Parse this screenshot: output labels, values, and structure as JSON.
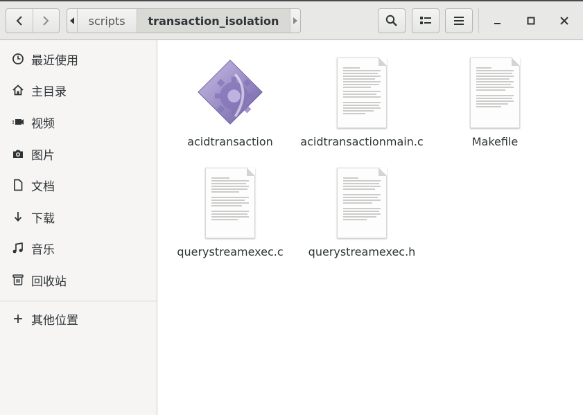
{
  "header": {
    "path": [
      "scripts",
      "transaction_isolation"
    ],
    "active_crumb": "transaction_isolation"
  },
  "sidebar": {
    "items": [
      {
        "label": "最近使用",
        "icon": "clock-icon"
      },
      {
        "label": "主目录",
        "icon": "home-icon"
      },
      {
        "label": "视频",
        "icon": "video-icon"
      },
      {
        "label": "图片",
        "icon": "camera-icon"
      },
      {
        "label": "文档",
        "icon": "document-icon"
      },
      {
        "label": "下载",
        "icon": "download-icon"
      },
      {
        "label": "音乐",
        "icon": "music-icon"
      },
      {
        "label": "回收站",
        "icon": "trash-icon"
      }
    ],
    "other": {
      "label": "其他位置",
      "icon": "plus-icon"
    }
  },
  "files": [
    {
      "name": "acidtransaction",
      "type": "executable"
    },
    {
      "name": "acidtransactionmain.c",
      "type": "text"
    },
    {
      "name": "Makefile",
      "type": "text"
    },
    {
      "name": "querystreamexec.c",
      "type": "text"
    },
    {
      "name": "querystreamexec.h",
      "type": "text"
    }
  ],
  "colors": {
    "header_bg": "#e8e8e7",
    "sidebar_bg": "#f6f5f4",
    "exec_icon": "#9d8fc7"
  }
}
